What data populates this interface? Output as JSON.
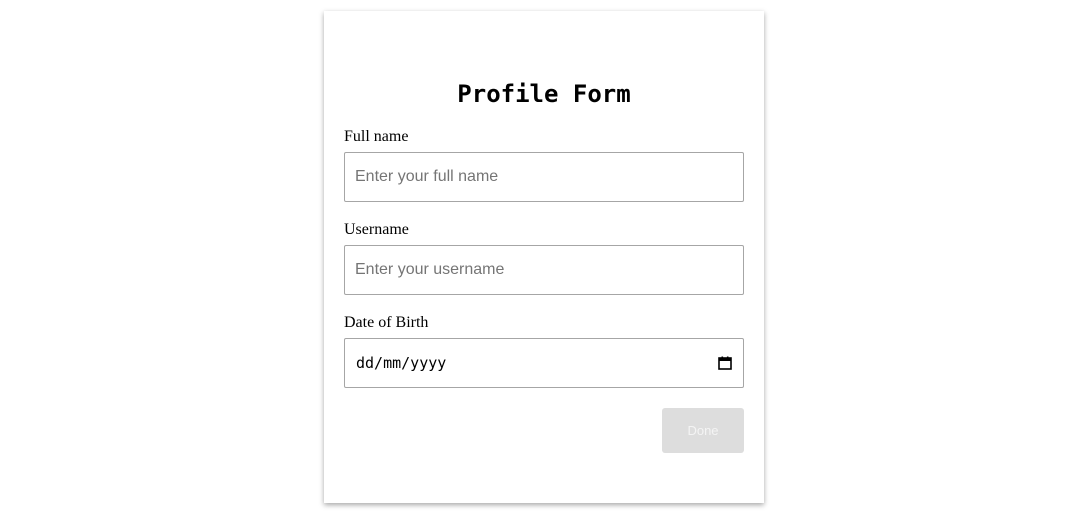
{
  "form": {
    "title": "Profile Form",
    "full_name": {
      "label": "Full name",
      "placeholder": "Enter your full name",
      "value": ""
    },
    "username": {
      "label": "Username",
      "placeholder": "Enter your username",
      "value": ""
    },
    "date_of_birth": {
      "label": "Date of Birth",
      "display": "dd/mm/yyyy",
      "icon": "calendar-icon"
    },
    "done_label": "Done",
    "done_enabled": false
  },
  "colors": {
    "button_disabled_bg": "#dddddd",
    "button_disabled_text": "#f4f4f4",
    "input_border": "#a6a6a6",
    "placeholder": "#757575"
  }
}
